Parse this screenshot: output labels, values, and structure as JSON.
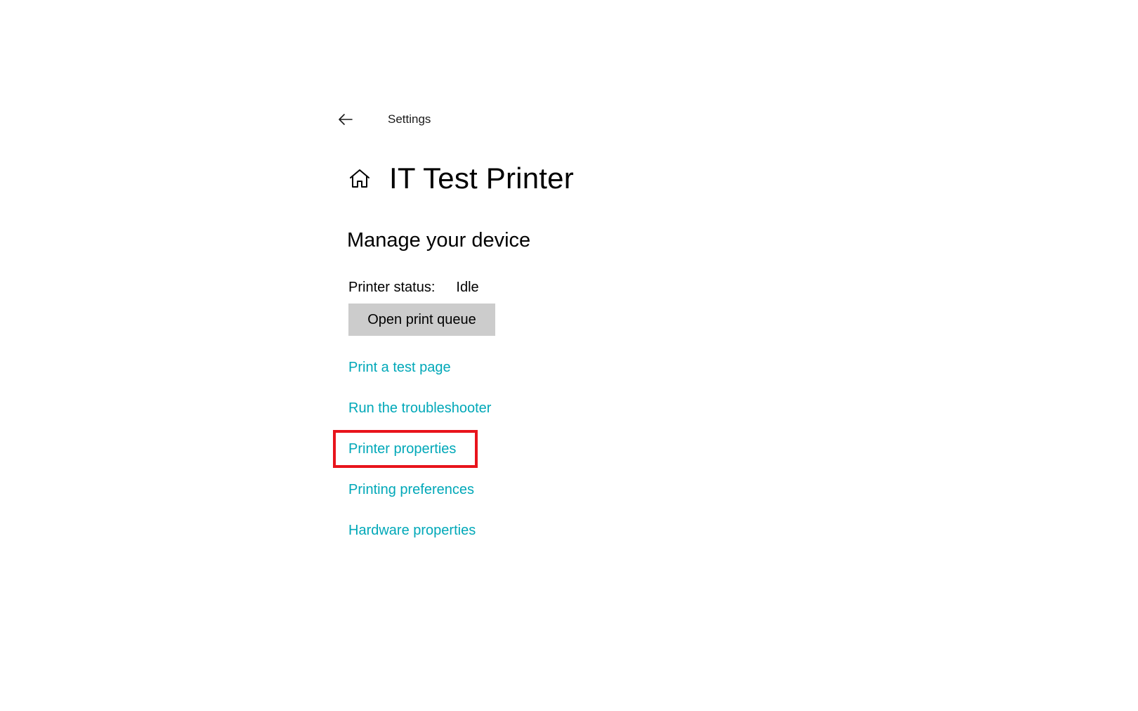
{
  "window": {
    "app_title": "Settings",
    "back_icon": "arrow-left-icon",
    "home_icon": "home-icon"
  },
  "page": {
    "title": "IT Test Printer",
    "section_title": "Manage your device"
  },
  "status": {
    "label": "Printer status:",
    "value": "Idle"
  },
  "actions": {
    "open_queue_label": "Open print queue"
  },
  "links": [
    {
      "label": "Print a test page"
    },
    {
      "label": "Run the troubleshooter"
    },
    {
      "label": "Printer properties"
    },
    {
      "label": "Printing preferences"
    },
    {
      "label": "Hardware properties"
    }
  ],
  "colors": {
    "link": "#00a8b8",
    "button_bg": "#cccccc",
    "highlight": "#e8141c"
  },
  "highlight": {
    "target": "Printer properties"
  }
}
